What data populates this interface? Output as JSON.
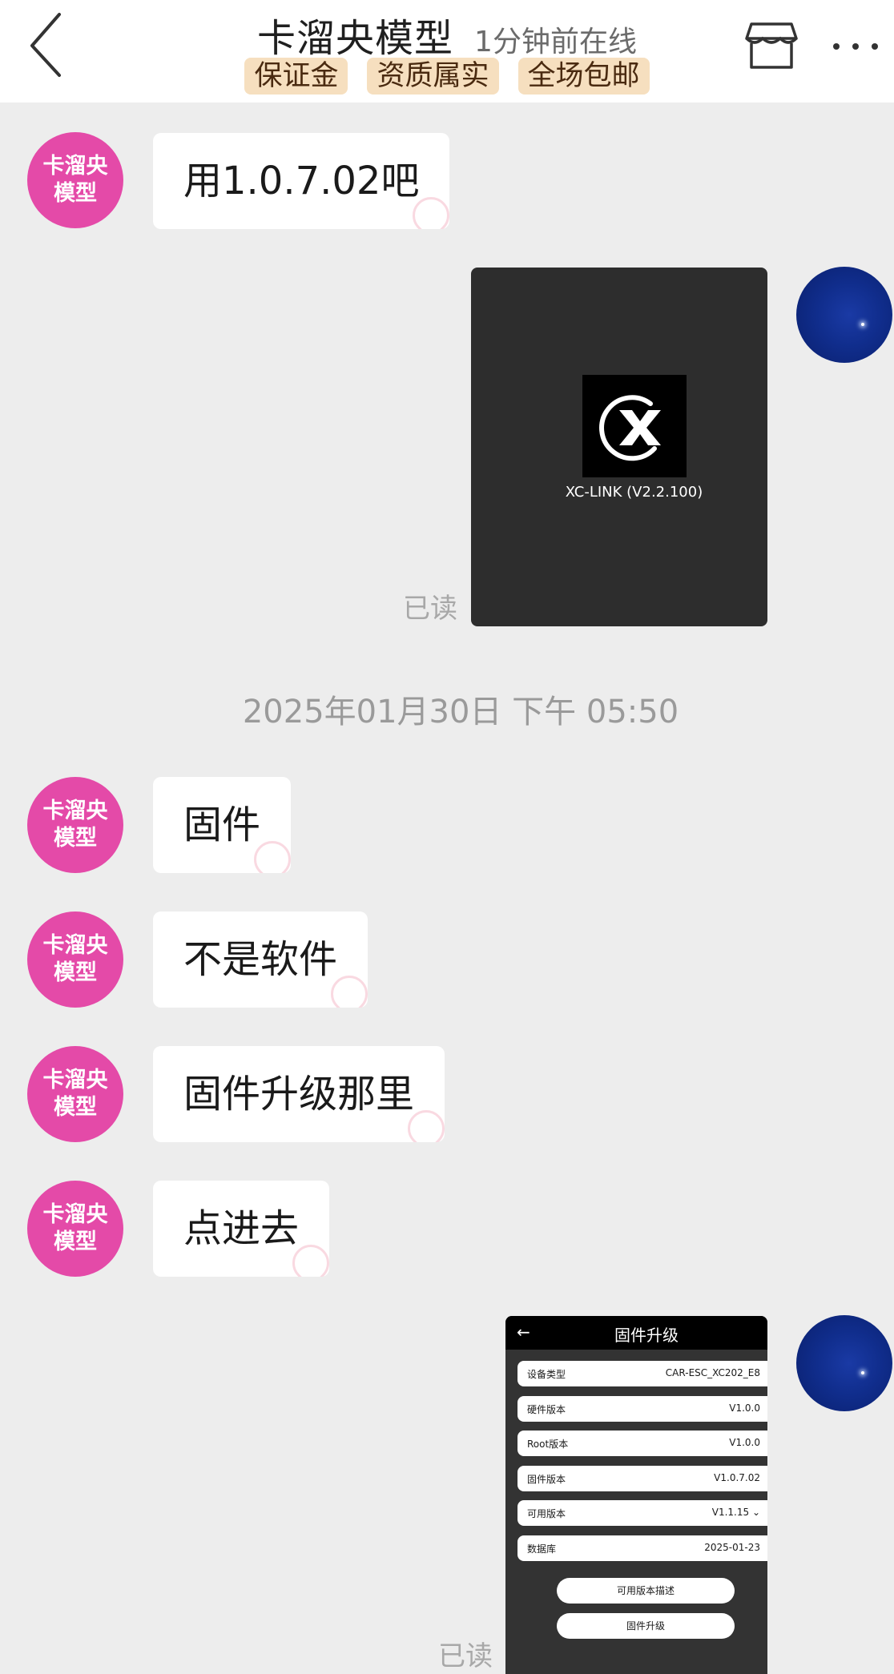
{
  "header": {
    "title": "卡溜央模型",
    "online_status": "1分钟前在线",
    "badges": [
      "保证金",
      "资质属实",
      "全场包邮"
    ]
  },
  "seller_avatar": {
    "line1": "卡溜央",
    "line2": "模型"
  },
  "messages": {
    "m1": "用1.0.7.02吧",
    "m2": "固件",
    "m3": "不是软件",
    "m4": "固件升级那里",
    "m5": "点进去"
  },
  "read_label": "已读",
  "timestamp": "2025年01月30日 下午 05:50",
  "image1": {
    "caption": "XC-LINK (V2.2.100)"
  },
  "image2": {
    "title": "固件升级",
    "back_glyph": "←",
    "rows": [
      {
        "key": "设备类型",
        "value": "CAR-ESC_XC202_E8"
      },
      {
        "key": "硬件版本",
        "value": "V1.0.0"
      },
      {
        "key": "Root版本",
        "value": "V1.0.0"
      },
      {
        "key": "固件版本",
        "value": "V1.0.7.02"
      },
      {
        "key": "可用版本",
        "value": "V1.1.15 ⌄"
      },
      {
        "key": "数据库",
        "value": "2025-01-23"
      }
    ],
    "buttons": [
      "可用版本描述",
      "固件升级"
    ]
  },
  "icons": {
    "back": "chevron-left-icon",
    "store": "store-icon",
    "more": "more-dots-icon"
  }
}
